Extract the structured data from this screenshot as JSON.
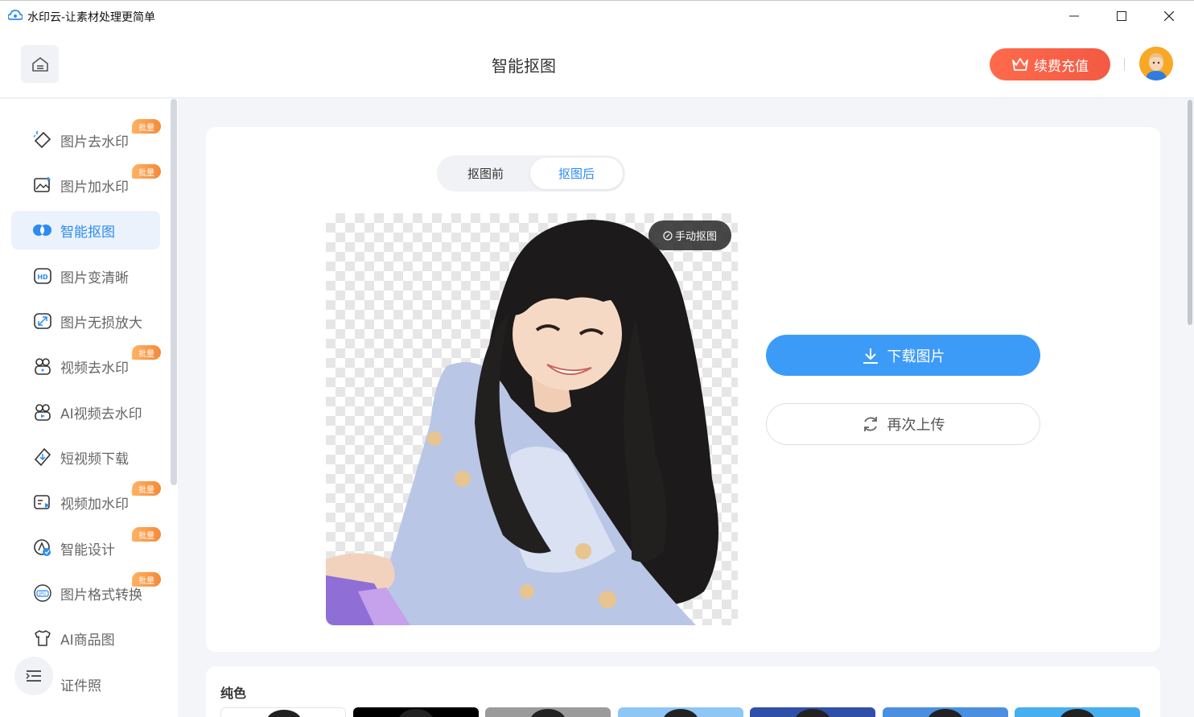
{
  "window": {
    "title": "水印云-让素材处理更简单",
    "controls": {
      "minimize": "—",
      "maximize": "☐",
      "close": "✕"
    }
  },
  "header": {
    "page_title": "智能抠图",
    "renew_label": "续费充值",
    "home_icon": "home-icon",
    "accent": "#2d8cf0"
  },
  "sidebar": {
    "items": [
      {
        "label": "图片去水印",
        "icon": "eraser-icon",
        "badge": "批量",
        "active": false
      },
      {
        "label": "图片加水印",
        "icon": "image-add-icon",
        "badge": "批量",
        "active": false
      },
      {
        "label": "智能抠图",
        "icon": "cutout-icon",
        "badge": "",
        "active": true
      },
      {
        "label": "图片变清晰",
        "icon": "hd-icon",
        "badge": "",
        "active": false
      },
      {
        "label": "图片无损放大",
        "icon": "enlarge-icon",
        "badge": "",
        "active": false
      },
      {
        "label": "视频去水印",
        "icon": "video-erase-icon",
        "badge": "批量",
        "active": false
      },
      {
        "label": "AI视频去水印",
        "icon": "ai-video-icon",
        "badge": "",
        "active": false
      },
      {
        "label": "短视频下载",
        "icon": "download-video-icon",
        "badge": "",
        "active": false
      },
      {
        "label": "视频加水印",
        "icon": "video-add-icon",
        "badge": "批量",
        "active": false
      },
      {
        "label": "智能设计",
        "icon": "design-icon",
        "badge": "批量",
        "active": false
      },
      {
        "label": "图片格式转换",
        "icon": "jpg-icon",
        "badge": "批量",
        "active": false
      },
      {
        "label": "AI商品图",
        "icon": "shirt-icon",
        "badge": "",
        "active": false
      },
      {
        "label": "证件照",
        "icon": "id-photo-icon",
        "badge": "",
        "active": false
      }
    ]
  },
  "main": {
    "tabs": [
      {
        "label": "抠图前",
        "active": false
      },
      {
        "label": "抠图后",
        "active": true
      }
    ],
    "manual_cutout_label": "手动抠图",
    "download_label": "下载图片",
    "reupload_label": "再次上传",
    "solid_color_title": "纯色",
    "swatch_colors": [
      "#ffffff",
      "#000000",
      "#9b9b9b",
      "#8ec6f5",
      "#2f4fa8",
      "#4a8fe0",
      "#47aef0"
    ]
  }
}
